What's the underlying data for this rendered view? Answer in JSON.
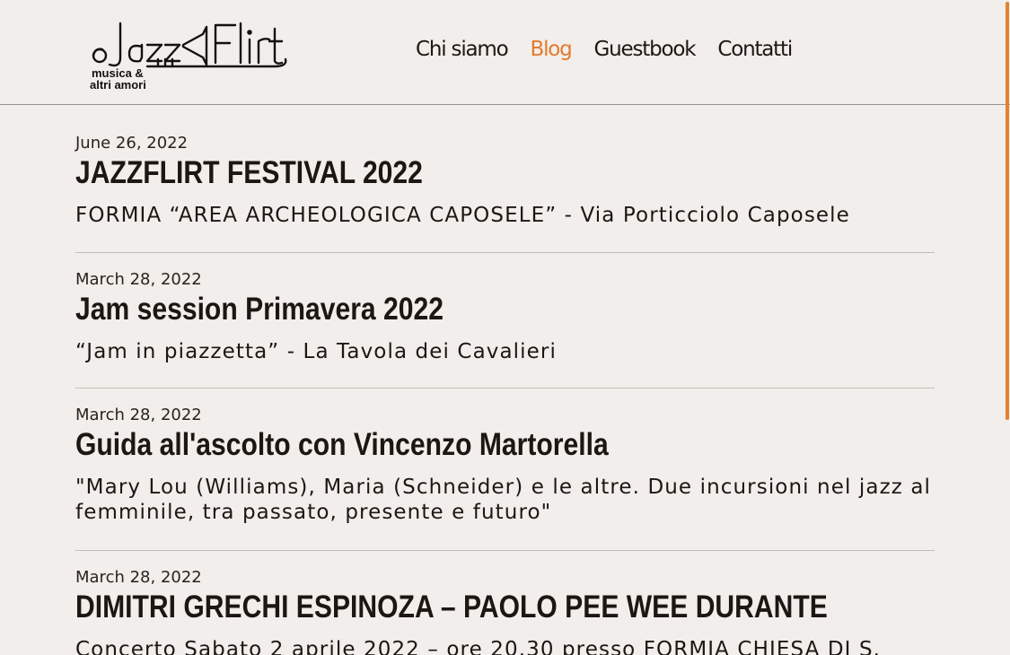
{
  "colors": {
    "background": "#f1eeeb",
    "accent": "#e57a2c",
    "text": "#1e1612"
  },
  "logo": {
    "brand": "Jazz Flirt",
    "tagline": "musica & altri amori"
  },
  "nav": {
    "items": [
      {
        "label": "Chi siamo",
        "active": false
      },
      {
        "label": "Blog",
        "active": true
      },
      {
        "label": "Guestbook",
        "active": false
      },
      {
        "label": "Contatti",
        "active": false
      }
    ]
  },
  "posts": [
    {
      "date": "June 26, 2022",
      "title": "JAZZFLIRT FESTIVAL 2022",
      "excerpt": "FORMIA “AREA ARCHEOLOGICA CAPOSELE” - Via Porticciolo Caposele"
    },
    {
      "date": "March 28, 2022",
      "title": "Jam session Primavera 2022",
      "excerpt": "“Jam in piazzetta” - La Tavola dei Cavalieri"
    },
    {
      "date": "March 28, 2022",
      "title": "Guida all'ascolto con Vincenzo Martorella",
      "excerpt": "\"Mary Lou (Williams), Maria (Schneider) e le altre. Due incursioni nel jazz al femminile, tra passato, presente e futuro\""
    },
    {
      "date": "March 28, 2022",
      "title": "DIMITRI GRECHI ESPINOZA – PAOLO PEE WEE DURANTE",
      "excerpt": "Concerto Sabato 2 aprile 2022 – ore 20.30 presso FORMIA CHIESA DI S."
    }
  ]
}
